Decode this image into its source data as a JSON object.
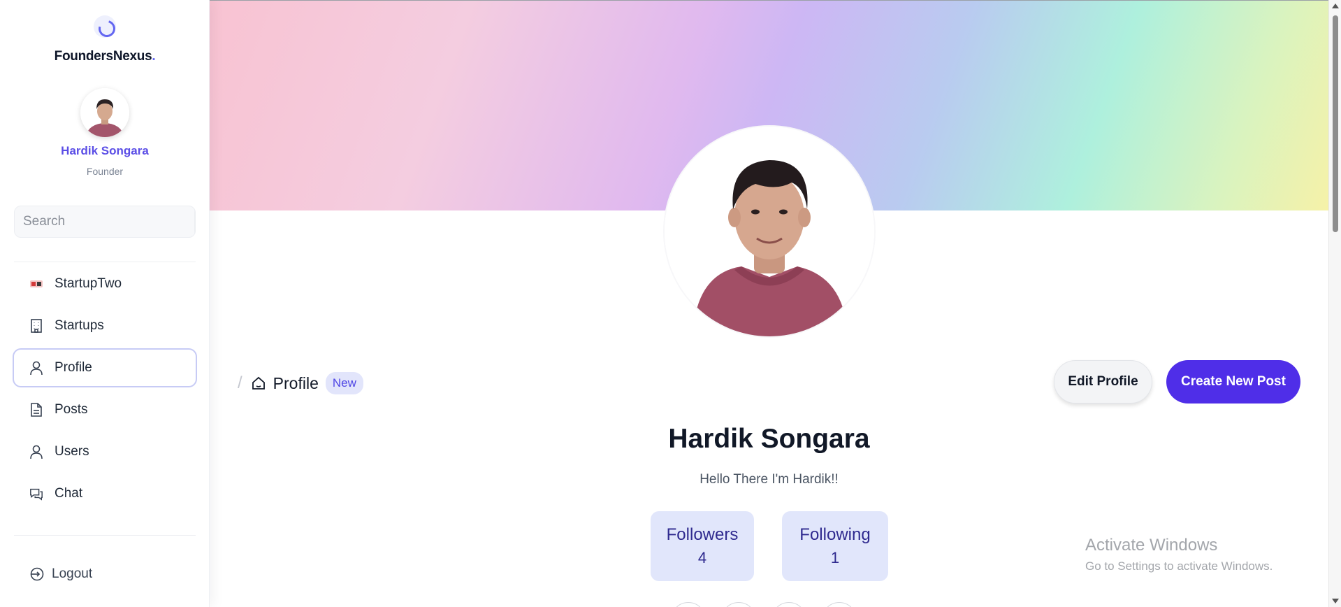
{
  "brand": {
    "name": "FoundersNexus",
    "dot": "."
  },
  "user": {
    "name": "Hardik Songara",
    "role": "Founder"
  },
  "search": {
    "placeholder": "Search"
  },
  "nav": [
    {
      "label": "StartupTwo",
      "icon": "startup-logo-icon"
    },
    {
      "label": "Startups",
      "icon": "building-icon"
    },
    {
      "label": "Profile",
      "icon": "user-icon",
      "active": true
    },
    {
      "label": "Posts",
      "icon": "document-icon"
    },
    {
      "label": "Users",
      "icon": "user-icon"
    },
    {
      "label": "Chat",
      "icon": "chat-icon"
    }
  ],
  "logout": {
    "label": "Logout"
  },
  "breadcrumb": {
    "separator": "/",
    "label": "Profile",
    "badge": "New"
  },
  "actions": {
    "edit_label": "Edit Profile",
    "create_label": "Create New Post"
  },
  "profile": {
    "name": "Hardik Songara",
    "bio": "Hello There I'm Hardik!!",
    "followers_label": "Followers",
    "followers_count": "4",
    "following_label": "Following",
    "following_count": "1"
  },
  "watermark": {
    "title": "Activate Windows",
    "subtitle": "Go to Settings to activate Windows."
  },
  "colors": {
    "accent": "#4f2ee8",
    "brand_purple": "#5b4ee6",
    "stat_bg": "#e1e6fb"
  }
}
